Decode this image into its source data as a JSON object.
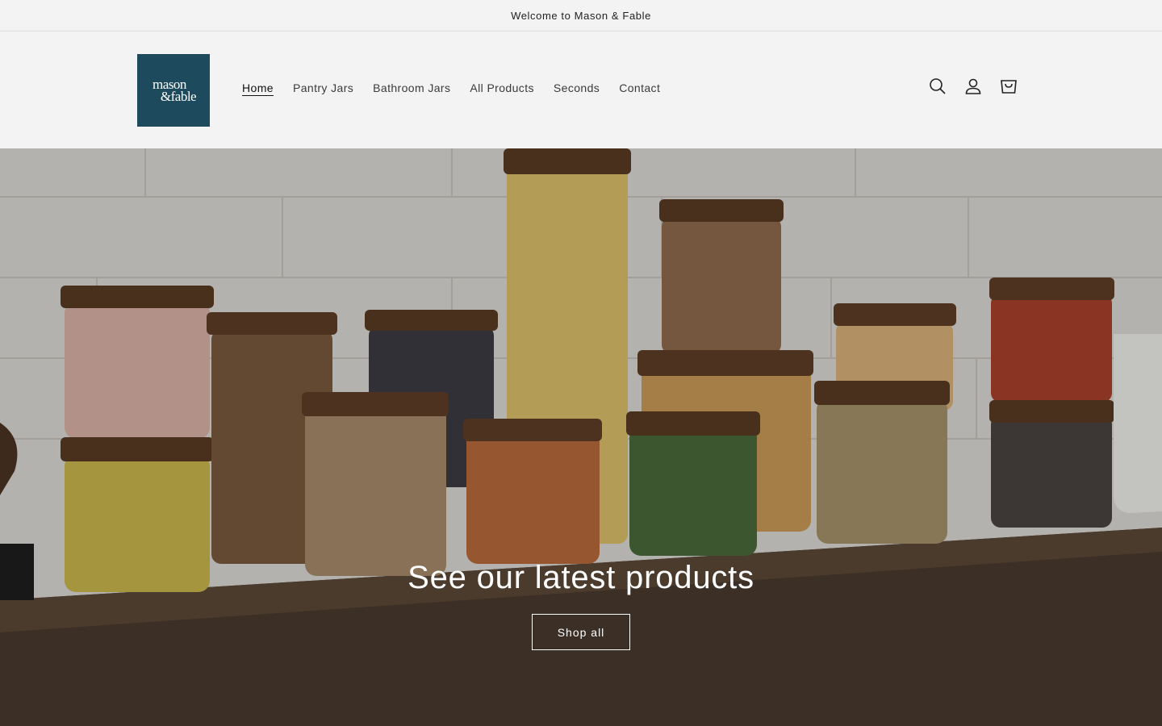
{
  "announcement": {
    "text": "Welcome to Mason & Fable"
  },
  "logo": {
    "line1": "mason",
    "line2": "&fable",
    "color": "#1d4a5c"
  },
  "nav": {
    "items": [
      {
        "label": "Home",
        "active": true
      },
      {
        "label": "Pantry Jars"
      },
      {
        "label": "Bathroom Jars"
      },
      {
        "label": "All Products"
      },
      {
        "label": "Seconds"
      },
      {
        "label": "Contact"
      }
    ]
  },
  "header_icons": [
    "search-icon",
    "account-icon",
    "cart-icon"
  ],
  "hero": {
    "title": "See our latest products",
    "button_label": "Shop all"
  }
}
